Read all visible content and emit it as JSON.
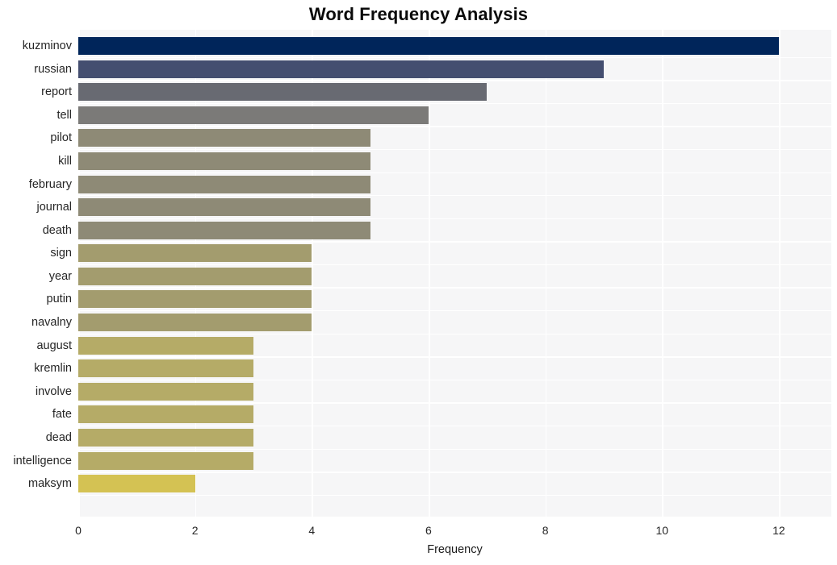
{
  "chart_data": {
    "type": "bar",
    "orientation": "horizontal",
    "title": "Word Frequency Analysis",
    "xlabel": "Frequency",
    "ylabel": "",
    "xlim": [
      0,
      12.9
    ],
    "ylim": [
      0,
      20
    ],
    "grid": true,
    "legend": null,
    "xticks": [
      "0",
      "2",
      "4",
      "6",
      "8",
      "10",
      "12"
    ],
    "xtick_values": [
      0,
      2,
      4,
      6,
      8,
      10,
      12
    ],
    "categories": [
      "kuzminov",
      "russian",
      "report",
      "tell",
      "pilot",
      "kill",
      "february",
      "journal",
      "death",
      "sign",
      "year",
      "putin",
      "navalny",
      "august",
      "kremlin",
      "involve",
      "fate",
      "dead",
      "intelligence",
      "maksym"
    ],
    "values": [
      12,
      9,
      7,
      6,
      5,
      5,
      5,
      5,
      5,
      4,
      4,
      4,
      4,
      3,
      3,
      3,
      3,
      3,
      3,
      2
    ],
    "bar_colors": [
      "#00255a",
      "#444e70",
      "#686a72",
      "#7b7a78",
      "#8e8a76",
      "#8e8a76",
      "#8e8a76",
      "#8e8a76",
      "#8e8a76",
      "#a39c6e",
      "#a39c6e",
      "#a39c6e",
      "#a39c6e",
      "#b5ab67",
      "#b5ab67",
      "#b5ab67",
      "#b5ab67",
      "#b5ab67",
      "#b5ab67",
      "#d4c253"
    ],
    "plot_background": "#f6f6f7",
    "grid_color": "#ffffff",
    "figure_background": "#ffffff",
    "text_color": "#262626"
  }
}
